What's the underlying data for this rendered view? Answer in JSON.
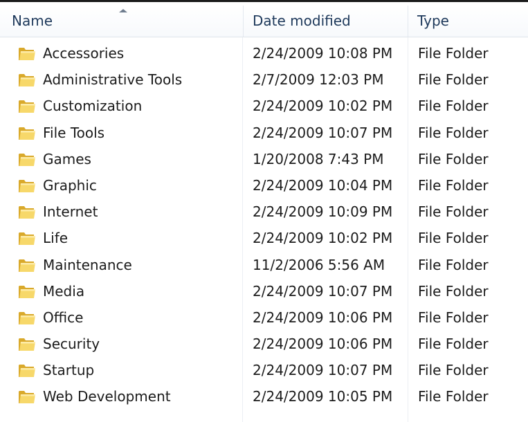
{
  "columns": {
    "name": "Name",
    "date": "Date modified",
    "type": "Type",
    "sorted_by": "Name",
    "sort_direction": "ascending"
  },
  "folder_icon": "folder-icon",
  "rows": [
    {
      "name": "Accessories",
      "date": "2/24/2009 10:08 PM",
      "type": "File Folder"
    },
    {
      "name": "Administrative Tools",
      "date": "2/7/2009 12:03 PM",
      "type": "File Folder"
    },
    {
      "name": "Customization",
      "date": "2/24/2009 10:02 PM",
      "type": "File Folder"
    },
    {
      "name": "File Tools",
      "date": "2/24/2009 10:07 PM",
      "type": "File Folder"
    },
    {
      "name": "Games",
      "date": "1/20/2008 7:43 PM",
      "type": "File Folder"
    },
    {
      "name": "Graphic",
      "date": "2/24/2009 10:04 PM",
      "type": "File Folder"
    },
    {
      "name": "Internet",
      "date": "2/24/2009 10:09 PM",
      "type": "File Folder"
    },
    {
      "name": "Life",
      "date": "2/24/2009 10:02 PM",
      "type": "File Folder"
    },
    {
      "name": "Maintenance",
      "date": "11/2/2006 5:56 AM",
      "type": "File Folder"
    },
    {
      "name": "Media",
      "date": "2/24/2009 10:07 PM",
      "type": "File Folder"
    },
    {
      "name": "Office",
      "date": "2/24/2009 10:06 PM",
      "type": "File Folder"
    },
    {
      "name": "Security",
      "date": "2/24/2009 10:06 PM",
      "type": "File Folder"
    },
    {
      "name": "Startup",
      "date": "2/24/2009 10:07 PM",
      "type": "File Folder"
    },
    {
      "name": "Web Development",
      "date": "2/24/2009 10:05 PM",
      "type": "File Folder"
    }
  ],
  "colors": {
    "header_text": "#1e395b",
    "row_text": "#1b1b1b",
    "folder_light": "#f7d86a",
    "folder_dark": "#d9a92b"
  }
}
